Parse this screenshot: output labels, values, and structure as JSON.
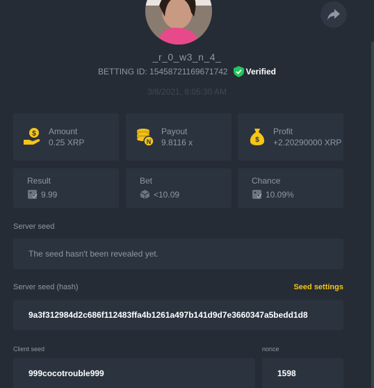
{
  "profile": {
    "username": "_r_0_w3_n_4_",
    "betting_id_label": "BETTING ID: 15458721169671742",
    "verified_label": "Verified",
    "timestamp": "3/8/2021, 8:05:30 AM"
  },
  "stats": {
    "amount": {
      "label": "Amount",
      "value": "0.25 XRP"
    },
    "payout": {
      "label": "Payout",
      "value": "9.8116 x"
    },
    "profit": {
      "label": "Profit",
      "value": "+2.20290000 XRP"
    }
  },
  "details": {
    "result": {
      "label": "Result",
      "value": "9.99"
    },
    "bet": {
      "label": "Bet",
      "value": "<10.09"
    },
    "chance": {
      "label": "Chance",
      "value": "10.09%"
    }
  },
  "seeds": {
    "server_seed_label": "Server seed",
    "server_seed_value": "The seed hasn't been revealed yet.",
    "server_hash_label": "Server seed (hash)",
    "seed_settings_link": "Seed settings",
    "server_hash_value": "9a3f312984d2c686f112483ffa4b1261a497b141d9d7e3660347a5bedd1d8",
    "client_seed_label": "Client seed",
    "client_seed_value": "999cocotrouble999",
    "nonce_label": "nonce",
    "nonce_value": "1598"
  },
  "colors": {
    "background": "#252c35",
    "card": "#2b333e",
    "accent_gold": "#f5c518",
    "verified_green": "#22c55e"
  },
  "icons": {
    "share": "share-icon",
    "verified": "shield-check-icon",
    "amount": "coin-hand-icon",
    "payout": "coin-stack-icon",
    "profit": "money-bag-icon",
    "dice": "dice-icon"
  }
}
